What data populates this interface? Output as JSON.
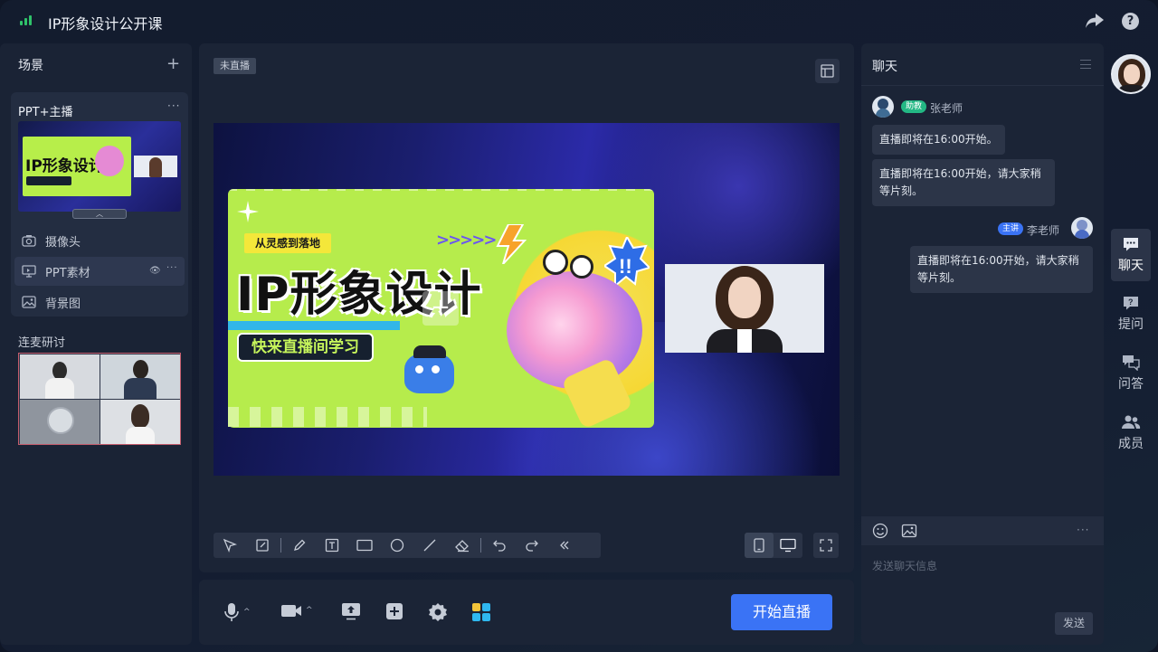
{
  "app": {
    "title": "IP形象设计公开课"
  },
  "scenes": {
    "header": "场景",
    "add": "+",
    "current": {
      "title": "PPT+主播",
      "more": "···"
    },
    "collapse": "︿",
    "items": [
      {
        "label": "摄像头",
        "icon": "camera-icon"
      },
      {
        "label": "PPT素材",
        "icon": "ppt-icon",
        "active": true
      },
      {
        "label": "背景图",
        "icon": "image-icon"
      }
    ],
    "item_eye": "👁",
    "item_more": "···",
    "lianmai": {
      "header": "连麦研讨"
    }
  },
  "stage": {
    "status_badge": "未直播",
    "slide": {
      "tag_top": "从灵感到落地",
      "title": "IP形象设计",
      "tag_bottom": "快来直播间学习",
      "arrows": ">>>>>",
      "add_symbol": "+"
    }
  },
  "toolbar": {
    "tools": [
      "select-cursor-icon",
      "edit-box-icon",
      "pen-icon",
      "text-icon",
      "rectangle-icon",
      "circle-icon",
      "line-icon",
      "eraser-icon",
      "undo-icon",
      "redo-icon",
      "collapse-icon"
    ]
  },
  "bottom": {
    "caret": "^",
    "start_button": "开始直播"
  },
  "chat": {
    "title": "聊天",
    "messages": [
      {
        "role": "助教",
        "name": "张老师",
        "side": "left",
        "role_color": "#23b884",
        "bubbles": [
          "直播即将在16:00开始。",
          "直播即将在16:00开始，请大家稍等片刻。"
        ]
      },
      {
        "role": "主讲",
        "name": "李老师",
        "side": "right",
        "role_color": "#3a73f5",
        "bubbles": [
          "直播即将在16:00开始，请大家稍等片刻。"
        ]
      }
    ],
    "tools_more": "···",
    "input_placeholder": "发送聊天信息",
    "send": "发送"
  },
  "rail": [
    {
      "label": "聊天",
      "icon": "chat-icon",
      "active": true
    },
    {
      "label": "提问",
      "icon": "question-icon"
    },
    {
      "label": "问答",
      "icon": "qa-icon"
    },
    {
      "label": "成员",
      "icon": "members-icon"
    }
  ],
  "colors": {
    "accent": "#3a73f5",
    "bg": "#131c2e",
    "panel": "#1b2436",
    "lime": "#b6ec4c"
  }
}
